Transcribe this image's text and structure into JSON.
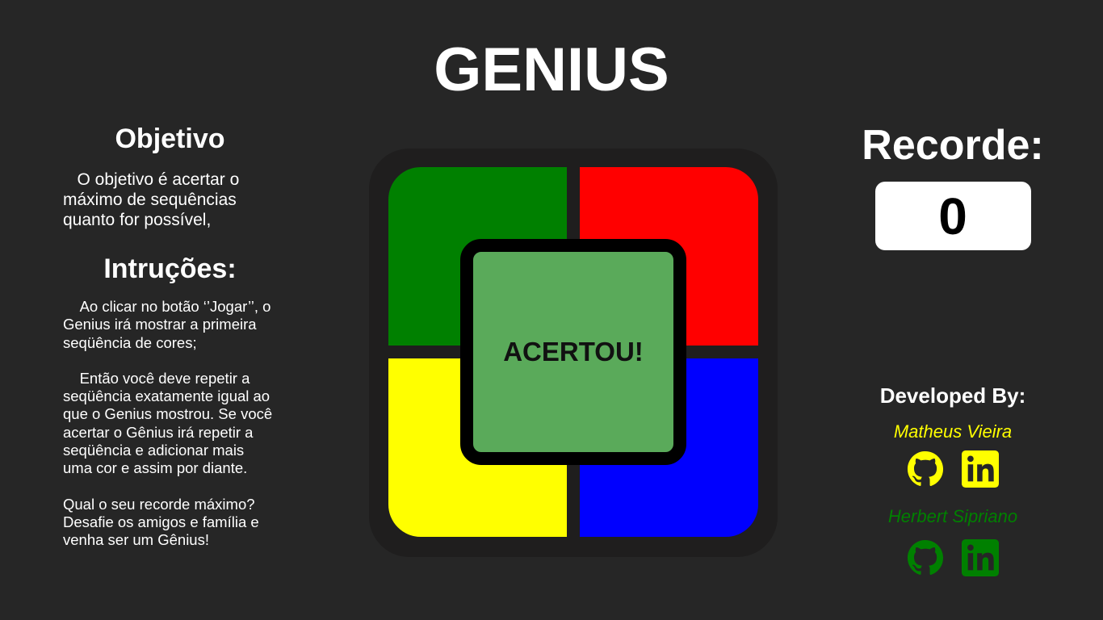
{
  "title": "GENIUS",
  "objective": {
    "heading": "Objetivo",
    "text": "   O objetivo é acertar o máximo de sequências quanto for possível,"
  },
  "instructions": {
    "heading": "Intruções:",
    "paragraphs": [
      "    Ao clicar no botão ‘’Jogar’’, o Genius irá mostrar a primeira seqüência de cores;",
      "    Então você deve repetir a seqüência exatamente igual ao que o Genius mostrou. Se você acertar o Gênius irá repetir a seqüência e adicionar mais uma cor e assim por diante.",
      "Qual o seu recorde máximo? Desafie os amigos e família e venha ser um Gênius!"
    ]
  },
  "board": {
    "center_label": "ACERTOU!",
    "colors": {
      "green": "#008000",
      "red": "#ff0000",
      "yellow": "#ffff00",
      "blue": "#0000ff",
      "center": "#5aaa5a"
    }
  },
  "record": {
    "label": "Recorde:",
    "value": "0"
  },
  "developers": {
    "heading": "Developed By:",
    "list": [
      {
        "name": "Matheus Vieira",
        "color": "#ffff00",
        "icons": [
          "github-icon",
          "linkedin-icon"
        ]
      },
      {
        "name": "Herbert Sipriano",
        "color": "#008000",
        "icons": [
          "github-icon",
          "linkedin-icon"
        ]
      }
    ]
  }
}
